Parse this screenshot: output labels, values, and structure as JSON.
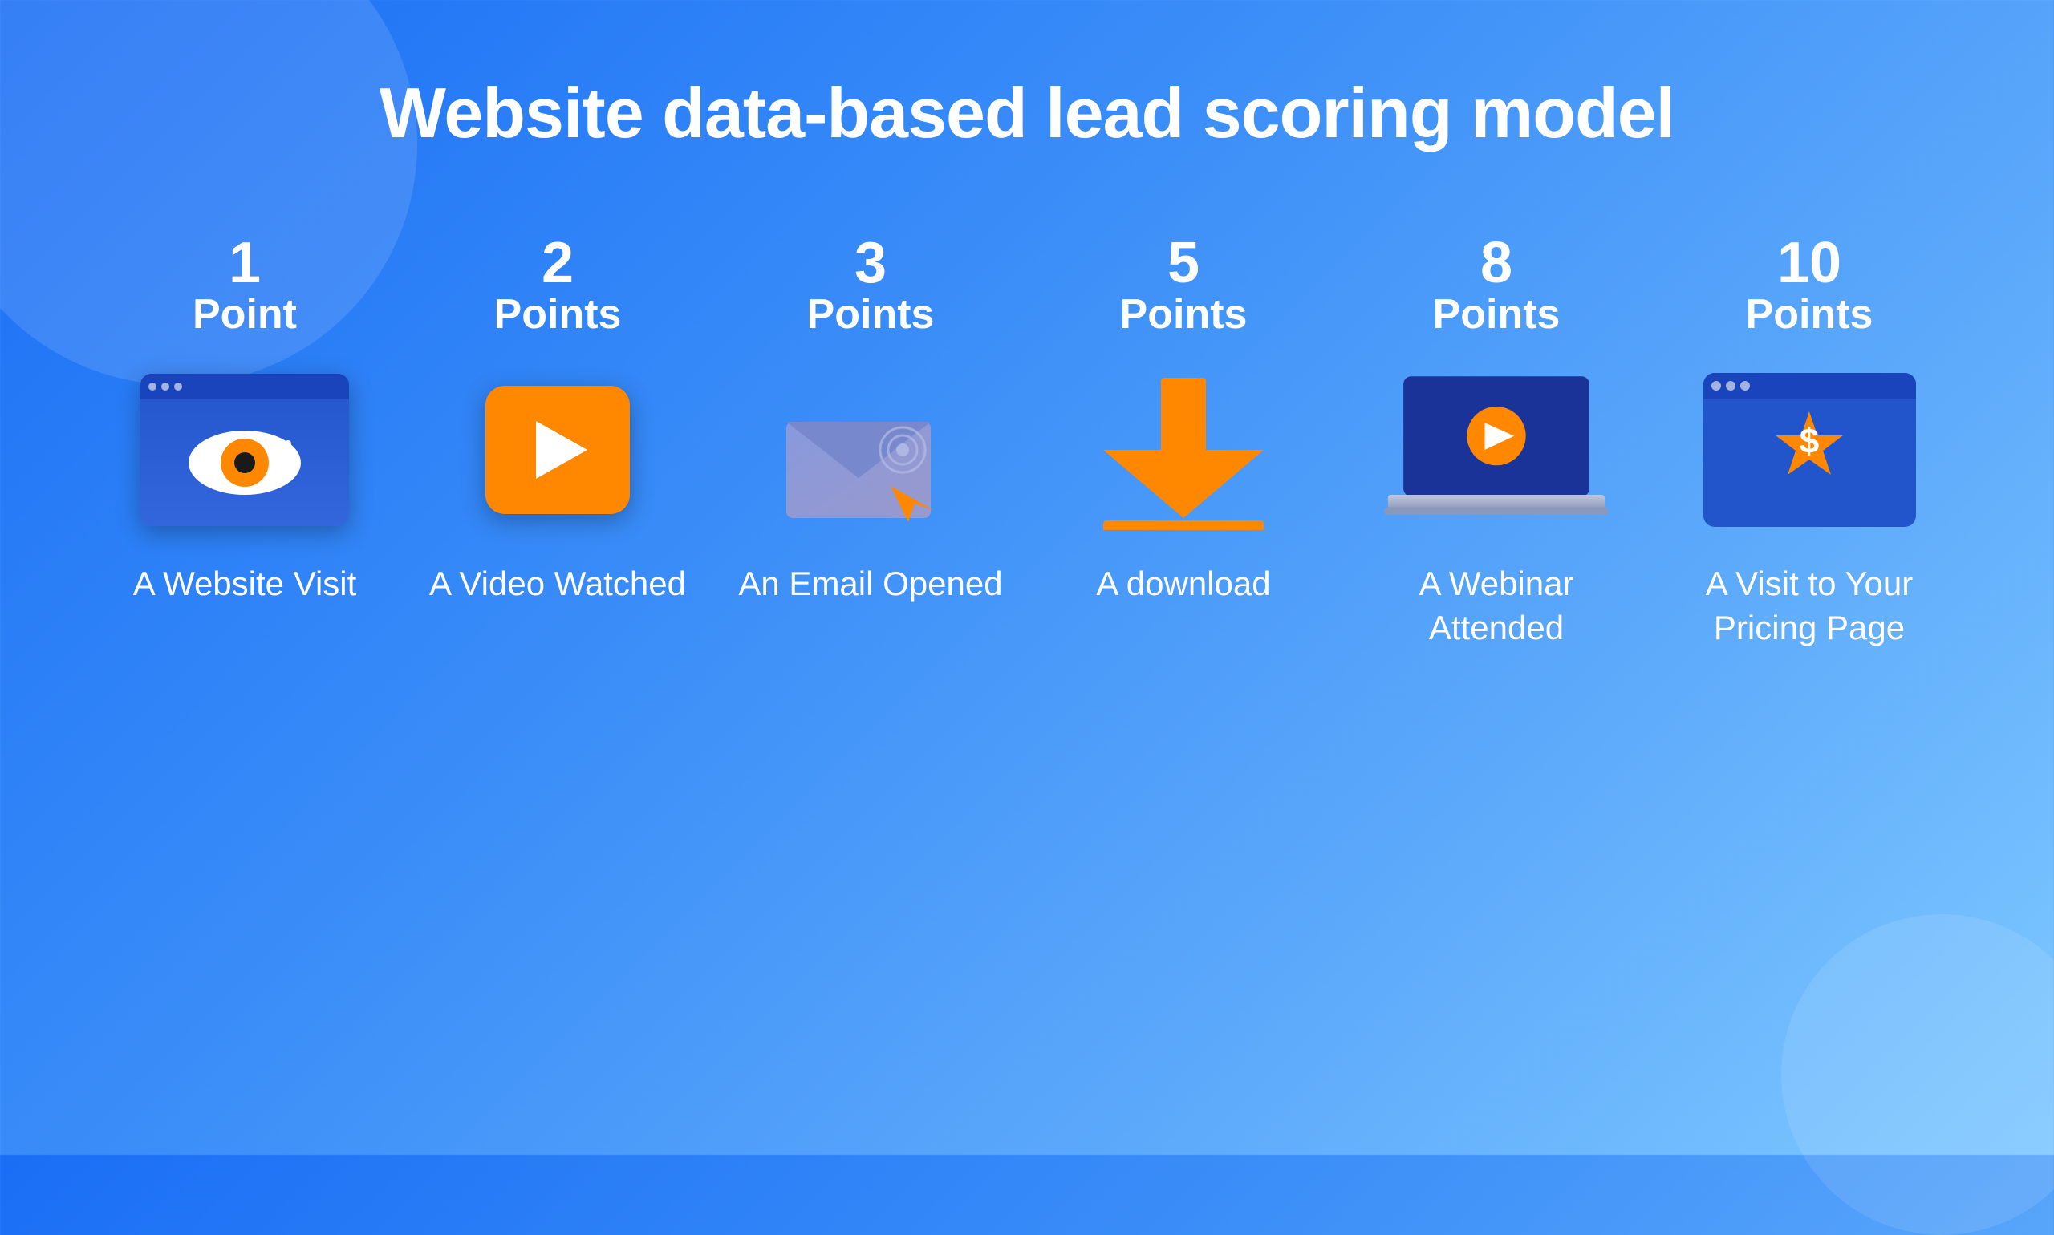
{
  "page": {
    "title": "Website data-based lead scoring model",
    "background_gradient_start": "#1a6ef5",
    "background_gradient_end": "#7ec8ff"
  },
  "cards": [
    {
      "id": "website-visit",
      "points_number": "1",
      "points_label": "Point",
      "label": "A Website Visit",
      "icon": "eye-browser-icon"
    },
    {
      "id": "video-watched",
      "points_number": "2",
      "points_label": "Points",
      "label": "A Video Watched",
      "icon": "video-play-icon"
    },
    {
      "id": "email-opened",
      "points_number": "3",
      "points_label": "Points",
      "label": "An Email Opened",
      "icon": "email-cursor-icon"
    },
    {
      "id": "download",
      "points_number": "5",
      "points_label": "Points",
      "label": "A download",
      "icon": "download-arrow-icon"
    },
    {
      "id": "webinar-attended",
      "points_number": "8",
      "points_label": "Points",
      "label": "A Webinar Attended",
      "icon": "laptop-video-icon"
    },
    {
      "id": "pricing-page",
      "points_number": "10",
      "points_label": "Points",
      "label": "A Visit to Your Pricing Page",
      "icon": "pricing-browser-icon"
    }
  ]
}
